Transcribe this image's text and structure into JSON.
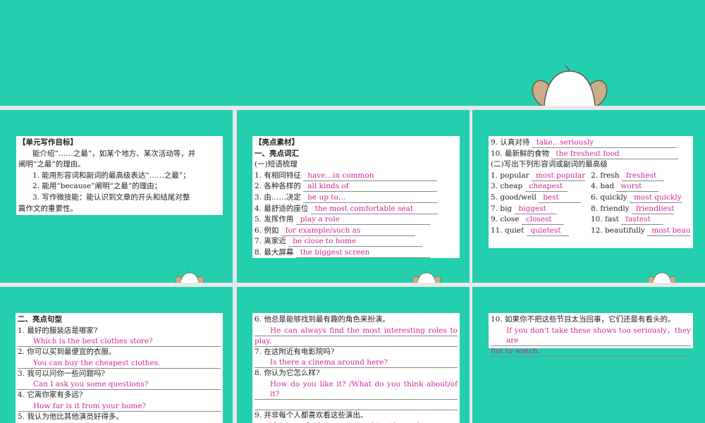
{
  "slide2": {
    "title": "【单元写作目标】",
    "intro": "能介绍“……之最”，如某个地方、某次活动等，并",
    "intro2": "阐明“之最”的理由。",
    "goals": [
      "1. 能用形容词和副词的最高级表达“……之最”；",
      "2. 能用“because”阐明“之最”的理由；",
      "3. 写作微技能：能认识到文章的开头和结尾对整",
      "篇作文的重要性。"
    ]
  },
  "slide3": {
    "title": "【亮点素材】",
    "section": "一、亮点词汇",
    "sub": "(一)短语梳理",
    "items": [
      {
        "q": "1. 有相同特征",
        "a": "have…in common"
      },
      {
        "q": "2. 各种各样的",
        "a": "all kinds of"
      },
      {
        "q": "3. 由……决定",
        "a": "be up to…"
      },
      {
        "q": "4. 最舒适的座位",
        "a": "the most comfortable seat"
      },
      {
        "q": "5. 发挥作用",
        "a": "play a role"
      },
      {
        "q": "6. 例如",
        "a": "for example/such as"
      },
      {
        "q": "7. 离家近",
        "a": "be close to home"
      },
      {
        "q": "8. 最大屏幕",
        "a": "the biggest screen"
      }
    ]
  },
  "slide4": {
    "items": [
      {
        "q": "9. 认真对待",
        "a": "take…seriously"
      },
      {
        "q": "10. 最新鲜的食物",
        "a": "the freshest food"
      }
    ],
    "sub": "(二)写出下列形容词或副词的最高级",
    "pairs": [
      {
        "q": "1. popular",
        "a": "most popular"
      },
      {
        "q": "2. fresh",
        "a": "freshest"
      },
      {
        "q": "3. cheap",
        "a": "cheapest"
      },
      {
        "q": "4. bad",
        "a": "worst"
      },
      {
        "q": "5. good/well",
        "a": "best"
      },
      {
        "q": "6. quickly",
        "a": "most quickly"
      },
      {
        "q": "7. big",
        "a": "biggest"
      },
      {
        "q": "8. friendly",
        "a": "friendliest"
      },
      {
        "q": "9. close",
        "a": "closest"
      },
      {
        "q": "10. fast",
        "a": "fastest"
      },
      {
        "q": "11. quiet",
        "a": "quietest"
      },
      {
        "q": "12. beautifully",
        "a": "most beautifully"
      }
    ]
  },
  "slide5": {
    "section": "二、亮点句型",
    "items": [
      {
        "q": "1. 最好的服装店是哪家?",
        "a": "Which is the best clothes store?"
      },
      {
        "q": "2. 你可以买到最便宜的衣服。",
        "a": "You can buy the cheapest clothes."
      },
      {
        "q": "3. 我可以问你一些问题吗?",
        "a": "Can I ask you some questions?"
      },
      {
        "q": "4. 它离你家有多远?",
        "a": "How far is it from your home?"
      },
      {
        "q": "5. 我认为他比其他演员好得多。",
        "a": ""
      }
    ]
  },
  "slide6": {
    "items": [
      {
        "q": "6. 他总是能够找到最有趣的角色来扮演。",
        "a": "He can always find the most interesting roles to",
        "a2": "play."
      },
      {
        "q": "7. 在这附近有电影院吗?",
        "a": "Is there a cinema around here?"
      },
      {
        "q": "8. 你认为它怎么样?",
        "a": "How do you like it? /What do you think about/of it?",
        "a2": ""
      },
      {
        "q": "9. 并非每个人都喜欢看这些演出。",
        "a": "Not everybody enjoys watching these shows."
      }
    ]
  },
  "slide7": {
    "q": "10. 如果你不把这些节目太当回事，它们还是有看头的。",
    "a": "If you don't take these shows too seriously，they are",
    "a2": "fun to watch."
  }
}
